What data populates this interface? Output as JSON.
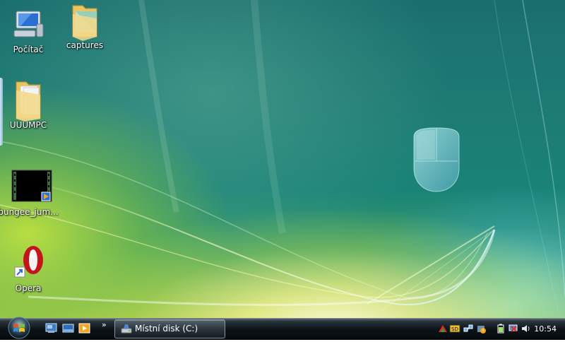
{
  "desktop": {
    "icons": [
      {
        "label": "Počítač",
        "icon": "computer-icon"
      },
      {
        "label": "captures",
        "icon": "folder-icon"
      },
      {
        "label": "UUUMPC",
        "icon": "folder-icon"
      },
      {
        "label": "bungee_jum...",
        "icon": "video-file-icon"
      },
      {
        "label": "Opera",
        "icon": "opera-icon"
      }
    ]
  },
  "taskbar": {
    "start_icon": "windows-orb-icon",
    "quick_launch": [
      {
        "icon": "show-desktop-icon"
      },
      {
        "icon": "switch-windows-icon"
      },
      {
        "icon": "media-player-icon"
      }
    ],
    "overflow_label": "»",
    "window_button": {
      "label": "Místní disk (C:)",
      "icon": "drive-icon"
    },
    "tray": {
      "icons": [
        "arrow-app-icon",
        "sd-card-icon",
        "network-icon",
        "security-alert-icon",
        "battery-icon",
        "network-disconnected-icon",
        "volume-icon"
      ],
      "clock": "10:54"
    }
  }
}
